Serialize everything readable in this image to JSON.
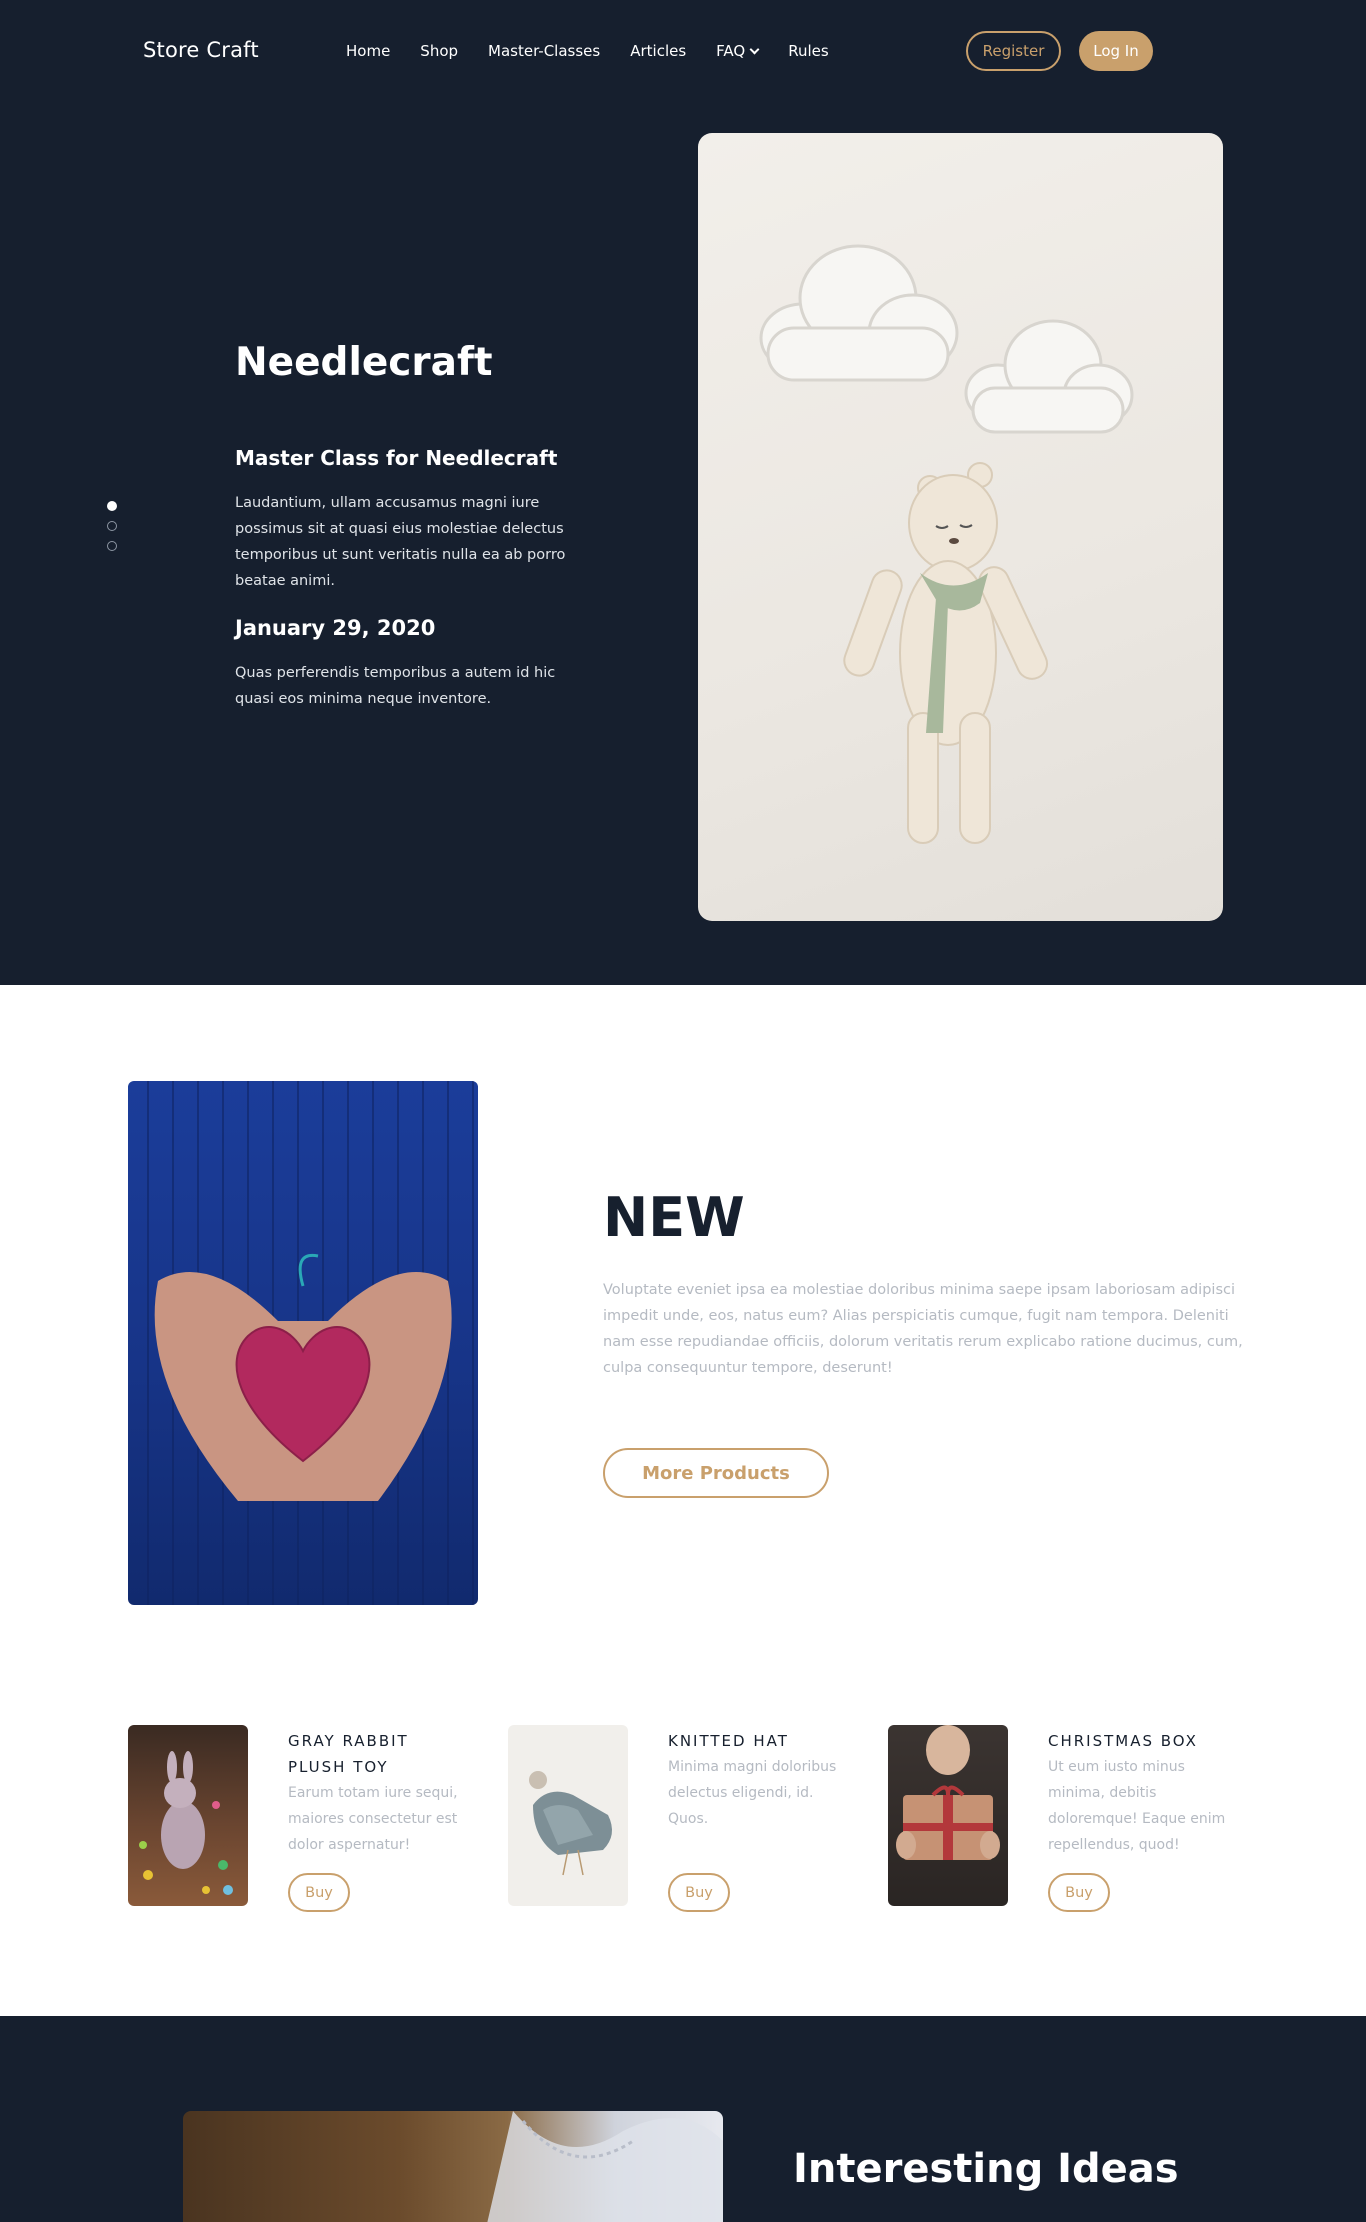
{
  "header": {
    "brand": "Store Craft",
    "nav": [
      "Home",
      "Shop",
      "Master-Classes",
      "Articles",
      "FAQ",
      "Rules"
    ],
    "register_label": "Register",
    "login_label": "Log In"
  },
  "hero": {
    "title": "Needlecraft",
    "subtitle": "Master Class for Needlecraft",
    "description": "Laudantium, ullam accusamus magni iure possimus sit at quasi eius molestiae delectus temporibus ut sunt veritatis nulla ea ab porro beatae animi.",
    "date": "January 29, 2020",
    "note": "Quas perferendis temporibus a autem id hic quasi eos minima neque inventore.",
    "slides_total": 3,
    "active_slide": 1
  },
  "new_section": {
    "title": "NEW",
    "description": "Voluptate eveniet ipsa ea molestiae doloribus minima saepe ipsam laboriosam adipisci impedit unde, eos, natus eum? Alias perspiciatis cumque, fugit nam tempora. Deleniti nam esse repudiandae officiis, dolorum veritatis rerum explicabo ratione ducimus, cum, culpa consequuntur tempore, deserunt!",
    "button_label": "More Products"
  },
  "products": [
    {
      "name": "GRAY RABBIT PLUSH TOY",
      "description": "Earum totam iure sequi, maiores consectetur est dolor aspernatur!",
      "buy_label": "Buy"
    },
    {
      "name": "KNITTED HAT",
      "description": "Minima magni doloribus delectus eligendi, id. Quos.",
      "buy_label": "Buy"
    },
    {
      "name": "CHRISTMAS BOX",
      "description": "Ut eum iusto minus minima, debitis doloremque! Eaque enim repellendus, quod!",
      "buy_label": "Buy"
    }
  ],
  "ideas": {
    "title": "Interesting Ideas"
  },
  "colors": {
    "dark_bg": "#161f2e",
    "accent": "#c9a06c",
    "muted_text": "#b5bac2"
  }
}
